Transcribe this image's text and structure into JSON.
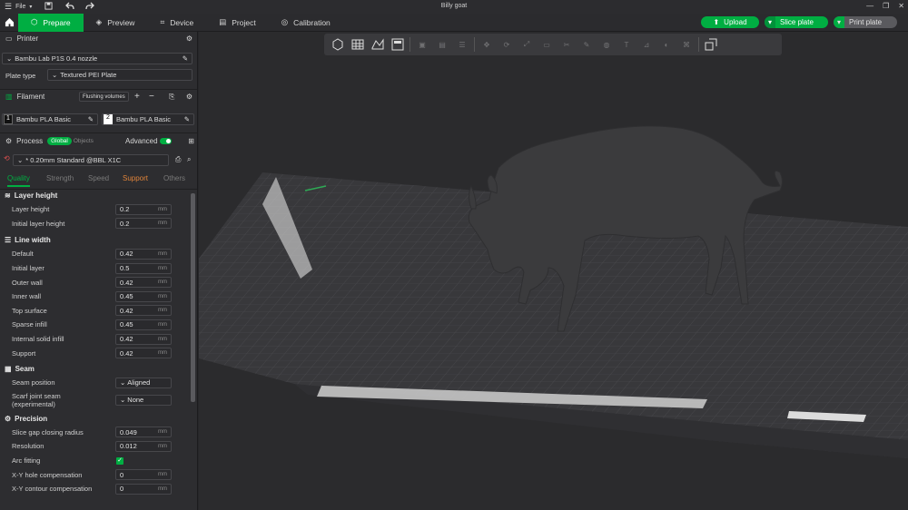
{
  "title": "Billy goat",
  "menu": {
    "file": "File"
  },
  "tabs": [
    {
      "label": "Prepare"
    },
    {
      "label": "Preview"
    },
    {
      "label": "Device"
    },
    {
      "label": "Project"
    },
    {
      "label": "Calibration"
    }
  ],
  "actions": {
    "upload": "Upload",
    "slice": "Slice plate",
    "print": "Print plate"
  },
  "printer": {
    "header": "Printer",
    "name": "Bambu Lab P1S 0.4 nozzle",
    "plate_label": "Plate type",
    "plate_value": "Textured PEI Plate"
  },
  "filament": {
    "header": "Filament",
    "flush": "Flushing volumes",
    "slots": [
      {
        "num": "1",
        "name": "Bambu PLA Basic",
        "color": "#111111"
      },
      {
        "num": "2",
        "name": "Bambu PLA Basic",
        "color": "#ffffff"
      }
    ]
  },
  "process": {
    "header": "Process",
    "global": "Global",
    "objects": "Objects",
    "advanced": "Advanced",
    "preset": "* 0.20mm Standard @BBL X1C"
  },
  "subtabs": [
    "Quality",
    "Strength",
    "Speed",
    "Support",
    "Others"
  ],
  "groups": {
    "layer_height": {
      "title": "Layer height",
      "rows": [
        {
          "label": "Layer height",
          "value": "0.2",
          "unit": "mm"
        },
        {
          "label": "Initial layer height",
          "value": "0.2",
          "unit": "mm"
        }
      ]
    },
    "line_width": {
      "title": "Line width",
      "rows": [
        {
          "label": "Default",
          "value": "0.42",
          "unit": "mm"
        },
        {
          "label": "Initial layer",
          "value": "0.5",
          "unit": "mm"
        },
        {
          "label": "Outer wall",
          "value": "0.42",
          "unit": "mm"
        },
        {
          "label": "Inner wall",
          "value": "0.45",
          "unit": "mm"
        },
        {
          "label": "Top surface",
          "value": "0.42",
          "unit": "mm"
        },
        {
          "label": "Sparse infill",
          "value": "0.45",
          "unit": "mm"
        },
        {
          "label": "Internal solid infill",
          "value": "0.42",
          "unit": "mm"
        },
        {
          "label": "Support",
          "value": "0.42",
          "unit": "mm"
        }
      ]
    },
    "seam": {
      "title": "Seam",
      "position_label": "Seam position",
      "position_value": "Aligned",
      "scarf_label1": "Scarf joint seam",
      "scarf_label2": "(experimental)",
      "scarf_value": "None"
    },
    "precision": {
      "title": "Precision",
      "rows": [
        {
          "label": "Slice gap closing radius",
          "value": "0.049",
          "unit": "mm"
        },
        {
          "label": "Resolution",
          "value": "0.012",
          "unit": "mm"
        },
        {
          "label": "Arc fitting",
          "value": "",
          "unit": ""
        },
        {
          "label": "X-Y hole compensation",
          "value": "0",
          "unit": "mm"
        },
        {
          "label": "X-Y contour compensation",
          "value": "0",
          "unit": "mm"
        }
      ]
    }
  },
  "colors": {
    "accent": "#00ae42",
    "support_tab": "#e0843a"
  }
}
